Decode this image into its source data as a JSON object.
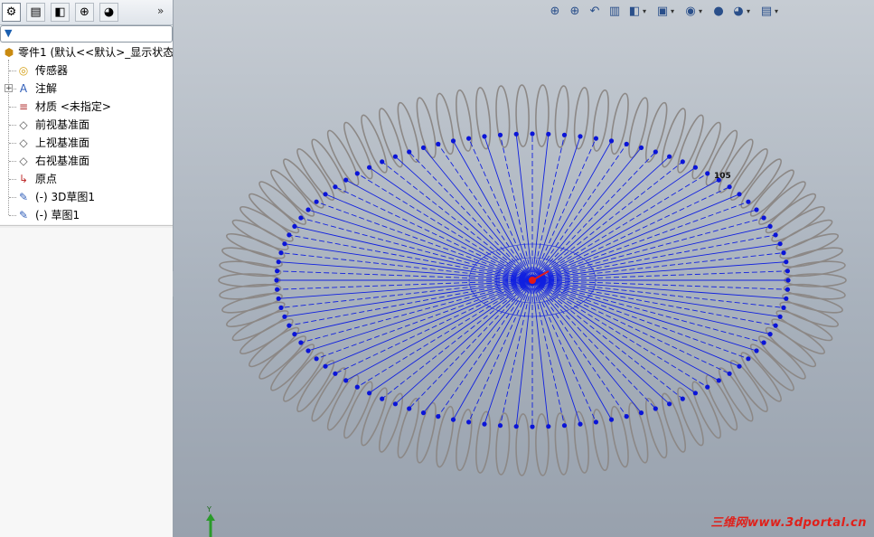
{
  "feature_tree": {
    "tabs": [
      {
        "name": "featuremanager-tab",
        "glyph": "⚙"
      },
      {
        "name": "propertymanager-tab",
        "glyph": "▤"
      },
      {
        "name": "configurationmanager-tab",
        "glyph": "◧"
      },
      {
        "name": "dimxpert-tab",
        "glyph": "⊕"
      },
      {
        "name": "display-manager-tab",
        "glyph": "◕"
      }
    ],
    "more_glyph": "»",
    "filter_glyph": "▼",
    "root_label": "零件1  (默认<<默认>_显示状态",
    "items": [
      {
        "label": "传感器",
        "icon": "sensor-icon",
        "glyph": "◎",
        "color": "#d4a017",
        "expandable": false
      },
      {
        "label": "注解",
        "icon": "annotation-icon",
        "glyph": "A",
        "color": "#2e5cb8",
        "expandable": true
      },
      {
        "label": "材质 <未指定>",
        "icon": "material-icon",
        "glyph": "≡",
        "color": "#b03030",
        "expandable": false
      },
      {
        "label": "前视基准面",
        "icon": "plane-icon",
        "glyph": "◇",
        "color": "#555555",
        "expandable": false
      },
      {
        "label": "上视基准面",
        "icon": "plane-icon",
        "glyph": "◇",
        "color": "#555555",
        "expandable": false
      },
      {
        "label": "右视基准面",
        "icon": "plane-icon",
        "glyph": "◇",
        "color": "#555555",
        "expandable": false
      },
      {
        "label": "原点",
        "icon": "origin-icon",
        "glyph": "↳",
        "color": "#c03030",
        "expandable": false
      },
      {
        "label": "(-) 3D草图1",
        "icon": "3d-sketch-icon",
        "glyph": "✎",
        "color": "#2e5cb8",
        "expandable": false
      },
      {
        "label": "(-) 草图1",
        "icon": "sketch-icon",
        "glyph": "✎",
        "color": "#2e5cb8",
        "expandable": false
      }
    ],
    "expander_glyph": "+"
  },
  "view_toolbar": {
    "buttons": [
      {
        "name": "zoom-to-fit-icon",
        "glyph": "⊕"
      },
      {
        "name": "zoom-to-area-icon",
        "glyph": "⊕"
      },
      {
        "name": "previous-view-icon",
        "glyph": "↶"
      },
      {
        "name": "section-view-icon",
        "glyph": "▥"
      },
      {
        "name": "view-orientation-icon",
        "glyph": "◧",
        "dropdown": true
      },
      {
        "name": "display-style-icon",
        "glyph": "▣",
        "dropdown": true
      },
      {
        "name": "hide-show-items-icon",
        "glyph": "◉",
        "dropdown": true
      },
      {
        "name": "edit-appearance-icon",
        "glyph": "●"
      },
      {
        "name": "apply-scene-icon",
        "glyph": "◕",
        "dropdown": true
      },
      {
        "name": "view-settings-icon",
        "glyph": "▤",
        "dropdown": true
      }
    ],
    "dropdown_glyph": "▾"
  },
  "graphics": {
    "dimension_label": "105",
    "triad_axis_label": "Y",
    "watermark": "三维网www.3dportal.cn",
    "colors": {
      "helix": "#8c8886",
      "sketch_lines": "#1020e0",
      "sketch_points": "#0a14d8",
      "origin": "#e01818",
      "background_top": "#c6ccd3",
      "background_bottom": "#98a1ad"
    }
  }
}
